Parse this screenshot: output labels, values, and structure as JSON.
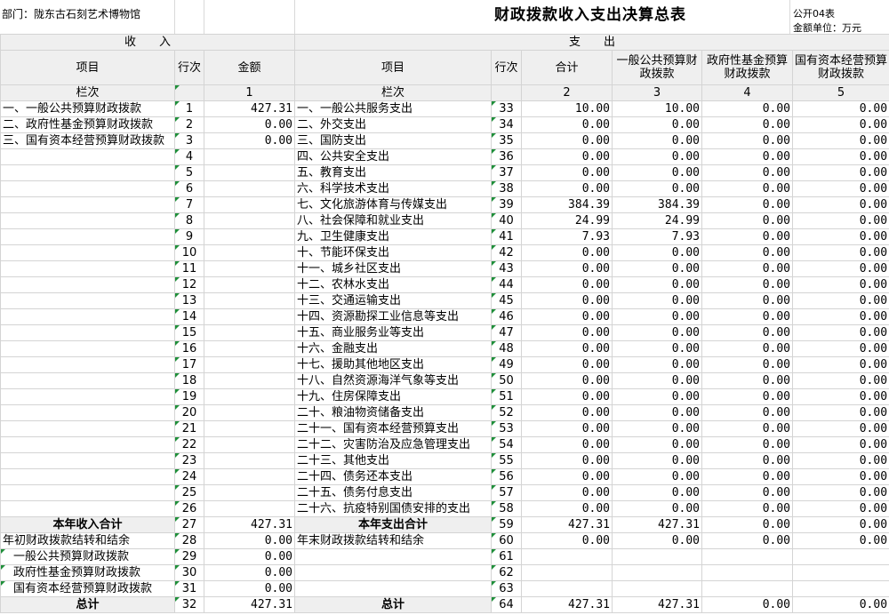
{
  "header": {
    "department": "部门：陇东古石刻艺术博物馆",
    "title": "财政拨款收入支出决算总表",
    "form_code": "公开04表",
    "unit": "金额单位：万元"
  },
  "sections": {
    "income": "收　　入",
    "expense": "支　　出"
  },
  "columns": {
    "item": "项目",
    "row_no": "行次",
    "amount": "金额",
    "exp_item": "项目",
    "exp_row_no": "行次",
    "total": "合计",
    "general": "一般公共预算财政拨款",
    "fund": "政府性基金预算财政拨款",
    "soe": "国有资本经营预算财政拨款"
  },
  "column_index": {
    "label": "栏次",
    "c1": "1",
    "exp_label": "栏次",
    "c2": "2",
    "c3": "3",
    "c4": "4",
    "c5": "5"
  },
  "rows": [
    {
      "in_item": "一、一般公共预算财政拨款",
      "in_no": "1",
      "in_amt": "427.31",
      "ex_item": "一、一般公共服务支出",
      "ex_no": "33",
      "t": "10.00",
      "g": "10.00",
      "f": "0.00",
      "s": "0.00"
    },
    {
      "in_item": "二、政府性基金预算财政拨款",
      "in_no": "2",
      "in_amt": "0.00",
      "ex_item": "二、外交支出",
      "ex_no": "34",
      "t": "0.00",
      "g": "0.00",
      "f": "0.00",
      "s": "0.00"
    },
    {
      "in_item": "三、国有资本经营预算财政拨款",
      "in_no": "3",
      "in_amt": "0.00",
      "ex_item": "三、国防支出",
      "ex_no": "35",
      "t": "0.00",
      "g": "0.00",
      "f": "0.00",
      "s": "0.00"
    },
    {
      "in_item": "",
      "in_no": "4",
      "in_amt": "",
      "ex_item": "四、公共安全支出",
      "ex_no": "36",
      "t": "0.00",
      "g": "0.00",
      "f": "0.00",
      "s": "0.00"
    },
    {
      "in_item": "",
      "in_no": "5",
      "in_amt": "",
      "ex_item": "五、教育支出",
      "ex_no": "37",
      "t": "0.00",
      "g": "0.00",
      "f": "0.00",
      "s": "0.00"
    },
    {
      "in_item": "",
      "in_no": "6",
      "in_amt": "",
      "ex_item": "六、科学技术支出",
      "ex_no": "38",
      "t": "0.00",
      "g": "0.00",
      "f": "0.00",
      "s": "0.00"
    },
    {
      "in_item": "",
      "in_no": "7",
      "in_amt": "",
      "ex_item": "七、文化旅游体育与传媒支出",
      "ex_no": "39",
      "t": "384.39",
      "g": "384.39",
      "f": "0.00",
      "s": "0.00"
    },
    {
      "in_item": "",
      "in_no": "8",
      "in_amt": "",
      "ex_item": "八、社会保障和就业支出",
      "ex_no": "40",
      "t": "24.99",
      "g": "24.99",
      "f": "0.00",
      "s": "0.00"
    },
    {
      "in_item": "",
      "in_no": "9",
      "in_amt": "",
      "ex_item": "九、卫生健康支出",
      "ex_no": "41",
      "t": "7.93",
      "g": "7.93",
      "f": "0.00",
      "s": "0.00"
    },
    {
      "in_item": "",
      "in_no": "10",
      "in_amt": "",
      "ex_item": "十、节能环保支出",
      "ex_no": "42",
      "t": "0.00",
      "g": "0.00",
      "f": "0.00",
      "s": "0.00"
    },
    {
      "in_item": "",
      "in_no": "11",
      "in_amt": "",
      "ex_item": "十一、城乡社区支出",
      "ex_no": "43",
      "t": "0.00",
      "g": "0.00",
      "f": "0.00",
      "s": "0.00"
    },
    {
      "in_item": "",
      "in_no": "12",
      "in_amt": "",
      "ex_item": "十二、农林水支出",
      "ex_no": "44",
      "t": "0.00",
      "g": "0.00",
      "f": "0.00",
      "s": "0.00"
    },
    {
      "in_item": "",
      "in_no": "13",
      "in_amt": "",
      "ex_item": "十三、交通运输支出",
      "ex_no": "45",
      "t": "0.00",
      "g": "0.00",
      "f": "0.00",
      "s": "0.00"
    },
    {
      "in_item": "",
      "in_no": "14",
      "in_amt": "",
      "ex_item": "十四、资源勘探工业信息等支出",
      "ex_no": "46",
      "t": "0.00",
      "g": "0.00",
      "f": "0.00",
      "s": "0.00"
    },
    {
      "in_item": "",
      "in_no": "15",
      "in_amt": "",
      "ex_item": "十五、商业服务业等支出",
      "ex_no": "47",
      "t": "0.00",
      "g": "0.00",
      "f": "0.00",
      "s": "0.00"
    },
    {
      "in_item": "",
      "in_no": "16",
      "in_amt": "",
      "ex_item": "十六、金融支出",
      "ex_no": "48",
      "t": "0.00",
      "g": "0.00",
      "f": "0.00",
      "s": "0.00"
    },
    {
      "in_item": "",
      "in_no": "17",
      "in_amt": "",
      "ex_item": "十七、援助其他地区支出",
      "ex_no": "49",
      "t": "0.00",
      "g": "0.00",
      "f": "0.00",
      "s": "0.00"
    },
    {
      "in_item": "",
      "in_no": "18",
      "in_amt": "",
      "ex_item": "十八、自然资源海洋气象等支出",
      "ex_no": "50",
      "t": "0.00",
      "g": "0.00",
      "f": "0.00",
      "s": "0.00"
    },
    {
      "in_item": "",
      "in_no": "19",
      "in_amt": "",
      "ex_item": "十九、住房保障支出",
      "ex_no": "51",
      "t": "0.00",
      "g": "0.00",
      "f": "0.00",
      "s": "0.00"
    },
    {
      "in_item": "",
      "in_no": "20",
      "in_amt": "",
      "ex_item": "二十、粮油物资储备支出",
      "ex_no": "52",
      "t": "0.00",
      "g": "0.00",
      "f": "0.00",
      "s": "0.00"
    },
    {
      "in_item": "",
      "in_no": "21",
      "in_amt": "",
      "ex_item": "二十一、国有资本经营预算支出",
      "ex_no": "53",
      "t": "0.00",
      "g": "0.00",
      "f": "0.00",
      "s": "0.00"
    },
    {
      "in_item": "",
      "in_no": "22",
      "in_amt": "",
      "ex_item": "二十二、灾害防治及应急管理支出",
      "ex_no": "54",
      "t": "0.00",
      "g": "0.00",
      "f": "0.00",
      "s": "0.00"
    },
    {
      "in_item": "",
      "in_no": "23",
      "in_amt": "",
      "ex_item": "二十三、其他支出",
      "ex_no": "55",
      "t": "0.00",
      "g": "0.00",
      "f": "0.00",
      "s": "0.00"
    },
    {
      "in_item": "",
      "in_no": "24",
      "in_amt": "",
      "ex_item": "二十四、债务还本支出",
      "ex_no": "56",
      "t": "0.00",
      "g": "0.00",
      "f": "0.00",
      "s": "0.00"
    },
    {
      "in_item": "",
      "in_no": "25",
      "in_amt": "",
      "ex_item": "二十五、债务付息支出",
      "ex_no": "57",
      "t": "0.00",
      "g": "0.00",
      "f": "0.00",
      "s": "0.00"
    },
    {
      "in_item": "",
      "in_no": "26",
      "in_amt": "",
      "ex_item": "二十六、抗疫特别国债安排的支出",
      "ex_no": "58",
      "t": "0.00",
      "g": "0.00",
      "f": "0.00",
      "s": "0.00"
    }
  ],
  "income_total": {
    "label": "本年收入合计",
    "no": "27",
    "amount": "427.31"
  },
  "expense_total": {
    "label": "本年支出合计",
    "no": "59",
    "t": "427.31",
    "g": "427.31",
    "f": "0.00",
    "s": "0.00"
  },
  "carry_in": {
    "label": "年初财政拨款结转和结余",
    "no": "28",
    "amount": "0.00"
  },
  "carry_out": {
    "label": "年末财政拨款结转和结余",
    "no": "60",
    "t": "0.00",
    "g": "0.00",
    "f": "0.00",
    "s": "0.00"
  },
  "carry_sub": [
    {
      "label": "一般公共预算财政拨款",
      "no": "29",
      "amount": "0.00",
      "ex_no": "61"
    },
    {
      "label": "政府性基金预算财政拨款",
      "no": "30",
      "amount": "0.00",
      "ex_no": "62"
    },
    {
      "label": "国有资本经营预算财政拨款",
      "no": "31",
      "amount": "0.00",
      "ex_no": "63"
    }
  ],
  "grand": {
    "label": "总计",
    "no": "32",
    "amount": "427.31",
    "ex_label": "总计",
    "ex_no": "64",
    "t": "427.31",
    "g": "427.31",
    "f": "0.00",
    "s": "0.00"
  }
}
